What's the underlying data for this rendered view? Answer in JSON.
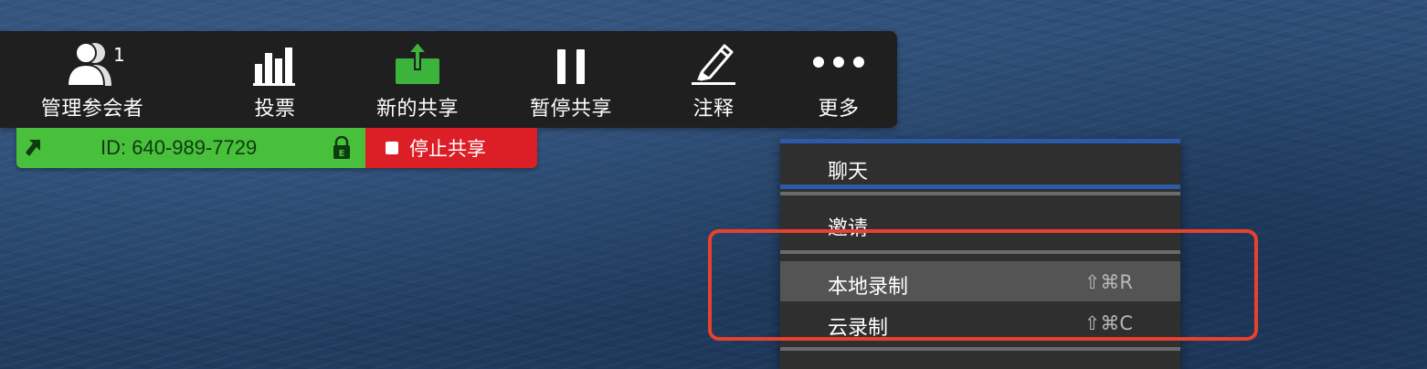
{
  "toolbar": {
    "participants": {
      "label": "管理参会者",
      "count": "1",
      "icon": "participants-icon"
    },
    "polling": {
      "label": "投票",
      "icon": "bar-chart-icon"
    },
    "new_share": {
      "label": "新的共享",
      "icon": "share-screen-icon"
    },
    "pause_share": {
      "label": "暂停共享",
      "icon": "pause-icon"
    },
    "annotate": {
      "label": "注释",
      "icon": "pencil-icon"
    },
    "more": {
      "label": "更多",
      "icon": "more-dots-icon"
    }
  },
  "meeting_bar": {
    "id_text": "ID: 640-989-7729",
    "stop_label": "停止共享",
    "encryption_icon": "lock-icon",
    "colors": {
      "green": "#48c03c",
      "red": "#dc1f26"
    }
  },
  "menu": {
    "chat": {
      "label": "聊天"
    },
    "invite": {
      "label": "邀请"
    },
    "local_record": {
      "label": "本地录制",
      "shortcut": "⇧⌘R"
    },
    "cloud_record": {
      "label": "云录制",
      "shortcut": "⇧⌘C"
    }
  },
  "colors": {
    "toolbar_bg": "#1f1f1f",
    "menu_bg": "#2f2f2f",
    "menu_highlight": "#545454",
    "menu_selected_accent": "#2b5aa8",
    "annotation": "#e8412d",
    "share_green": "#3cb43c"
  }
}
